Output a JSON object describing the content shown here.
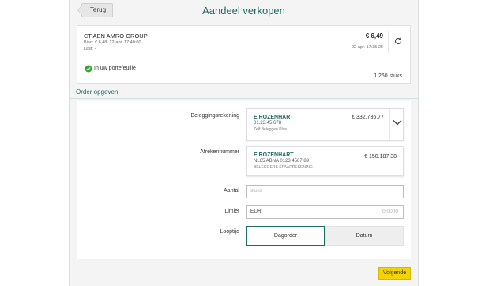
{
  "header": {
    "back_label": "Terug",
    "title": "Aandeel verkopen"
  },
  "security": {
    "name": "CT ABN AMRO GROUP",
    "bid_label": "Bied:",
    "bid_value": "€ 6,48",
    "bid_time": "22-apr. 17:40:00",
    "last_label": "Last:",
    "last_value": "-",
    "price": "€ 6,49",
    "price_time": "22-apr. 17:35:25",
    "refresh_icon": "refresh-icon"
  },
  "portfolio": {
    "status": "In uw portefeuille",
    "quantity": "1.260 stuks",
    "status_icon": "check-circle-icon",
    "status_color": "#3aa335"
  },
  "order": {
    "section_title": "Order opgeven",
    "investment_account": {
      "label": "Beleggingsrekening",
      "name": "E ROZENHART",
      "number": "01.23.45.678",
      "type": "Zelf Beleggen Plus",
      "balance": "€ 332.736,77"
    },
    "settlement_account": {
      "label": "Afrekennummer",
      "name": "E ROZENHART",
      "iban": "NL65 ABNA 0123 4567 89",
      "type": "BELEGGERS SPAARREKENING",
      "balance": "€ 150.187,38"
    },
    "quantity": {
      "label": "Aantal",
      "placeholder": "stuks"
    },
    "limit": {
      "label": "Limiet",
      "currency": "EUR",
      "placeholder": "0,0000"
    },
    "duration": {
      "label": "Looptijd",
      "options": [
        "Dagorder",
        "Datum"
      ],
      "selected": "Dagorder"
    }
  },
  "footer": {
    "next_label": "Volgende"
  },
  "colors": {
    "accent": "#1d6b63",
    "button": "#f5d300"
  }
}
